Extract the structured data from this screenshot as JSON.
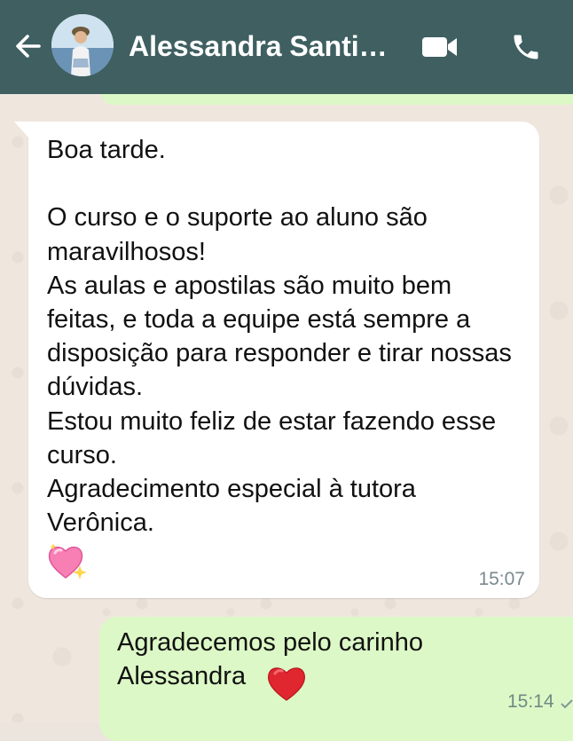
{
  "header": {
    "contact_name": "Alessandra Santi…",
    "icons": {
      "back": "arrow-left-icon",
      "video": "video-camera-icon",
      "call": "phone-icon"
    }
  },
  "messages": [
    {
      "direction": "incoming",
      "text": "Boa tarde.\n\nO curso e o suporte ao aluno são maravilhosos!\nAs aulas e apostilas são muito bem feitas, e toda a equipe está sempre a disposição para responder e tirar nossas dúvidas.\nEstou muito feliz de estar fazendo esse curso.\nAgradecimento especial à tutora Verônica.",
      "emoji": "sparkling-heart",
      "time": "15:07"
    },
    {
      "direction": "outgoing",
      "text": "Agradecemos pelo carinho\nAlessandra",
      "emoji": "red-heart",
      "time": "15:14"
    }
  ],
  "colors": {
    "header_bg": "#3F5F61",
    "chat_bg": "#EFE7DE",
    "incoming_bubble": "#FFFFFF",
    "outgoing_bubble": "#DCF8C6"
  }
}
